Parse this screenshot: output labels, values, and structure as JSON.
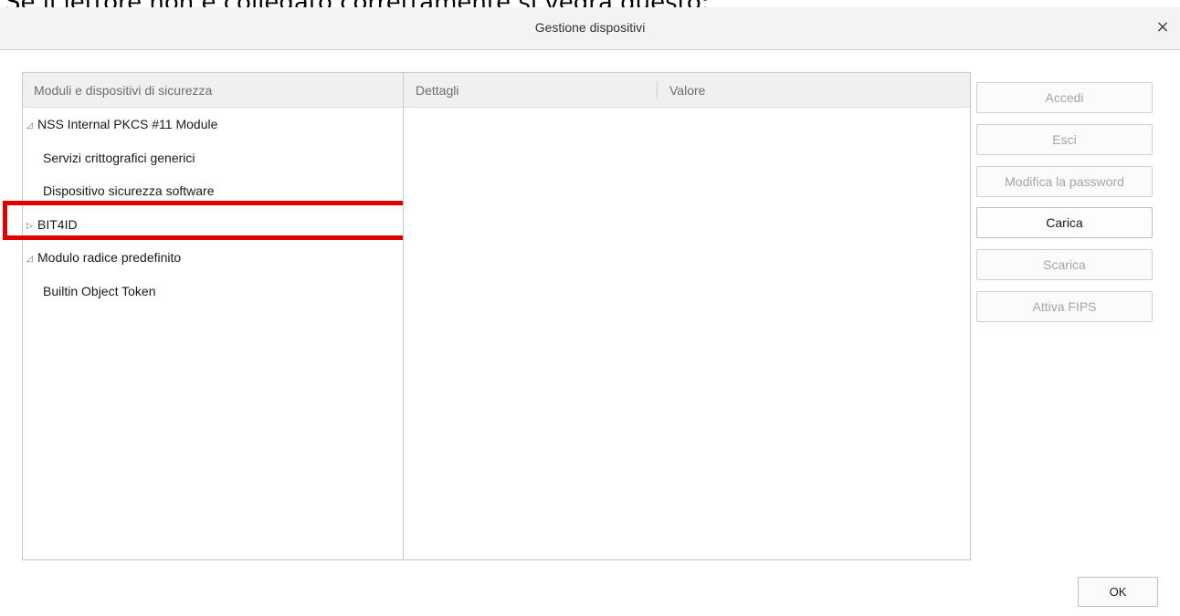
{
  "caption": "Se il lettore non è collegato correttamente si vedrà questo:",
  "dialog": {
    "title": "Gestione dispositivi",
    "close_label": "×"
  },
  "module_tree": {
    "header": "Moduli e dispositivi di sicurezza",
    "items": [
      {
        "label": "NSS Internal PKCS #11 Module",
        "level": 0,
        "twisty": "◿",
        "expanded": true
      },
      {
        "label": "Servizi crittografici generici",
        "level": 1
      },
      {
        "label": "Dispositivo sicurezza software",
        "level": 1
      },
      {
        "label": "BIT4ID",
        "level": 0,
        "twisty": "▷",
        "expanded": false,
        "highlighted": true
      },
      {
        "label": "Modulo radice predefinito",
        "level": 0,
        "twisty": "◿",
        "expanded": true
      },
      {
        "label": "Builtin Object Token",
        "level": 1
      }
    ]
  },
  "details": {
    "columns": [
      "Dettagli",
      "Valore"
    ]
  },
  "buttons": {
    "accedi": "Accedi",
    "esci": "Esci",
    "modifica_password": "Modifica la password",
    "carica": "Carica",
    "scarica": "Scarica",
    "attiva_fips": "Attiva FIPS",
    "ok": "OK"
  },
  "colors": {
    "highlight": "#e00000",
    "disabled_text": "#a5a5a5"
  }
}
